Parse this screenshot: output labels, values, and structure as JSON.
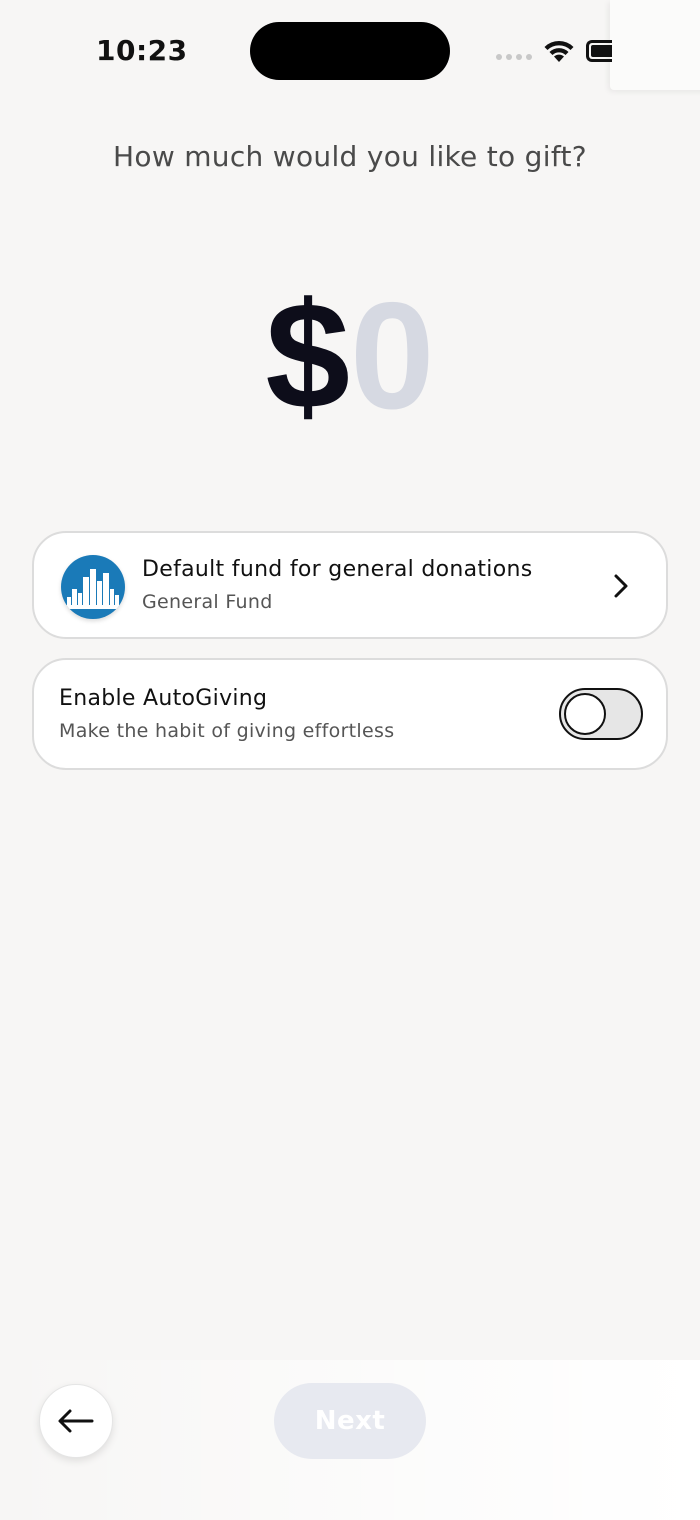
{
  "status_bar": {
    "time": "10:23"
  },
  "prompt": {
    "question": "How much would you like to gift?"
  },
  "amount": {
    "currency": "$",
    "value": "0"
  },
  "fund": {
    "title": "Default fund for general donations",
    "name": "General Fund",
    "logo_icon": "city-skyline-icon",
    "logo_color": "#1a7ab8"
  },
  "autogiving": {
    "title": "Enable AutoGiving",
    "subtitle": "Make the habit of giving effortless",
    "enabled": false
  },
  "footer": {
    "back_icon": "arrow-left-icon",
    "next_label": "Next",
    "next_enabled": false
  },
  "colors": {
    "background": "#f7f6f5",
    "amount_placeholder": "#d6d9e2",
    "next_disabled": "#e7e9f0"
  }
}
